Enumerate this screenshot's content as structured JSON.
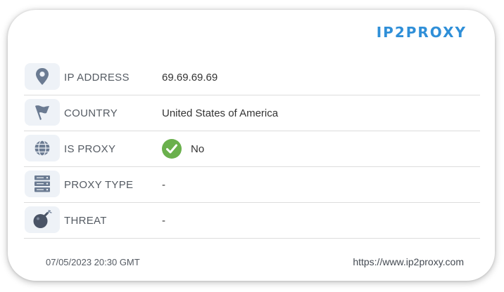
{
  "brand": {
    "logo_text": "IP2PROXY",
    "color": "#2f8fd8"
  },
  "rows": [
    {
      "label": "IP ADDRESS",
      "value": "69.69.69.69",
      "icon": "location-pin-icon"
    },
    {
      "label": "COUNTRY",
      "value": "United States of America",
      "icon": "flag-icon"
    },
    {
      "label": "IS PROXY",
      "value": "No",
      "icon": "globe-icon",
      "status_icon": "check-circle-icon",
      "status_color": "#6ab04c"
    },
    {
      "label": "PROXY TYPE",
      "value": "-",
      "icon": "server-icon"
    },
    {
      "label": "THREAT",
      "value": "-",
      "icon": "bomb-icon"
    }
  ],
  "footer": {
    "timestamp": "07/05/2023 20:30 GMT",
    "url": "https://www.ip2proxy.com"
  }
}
